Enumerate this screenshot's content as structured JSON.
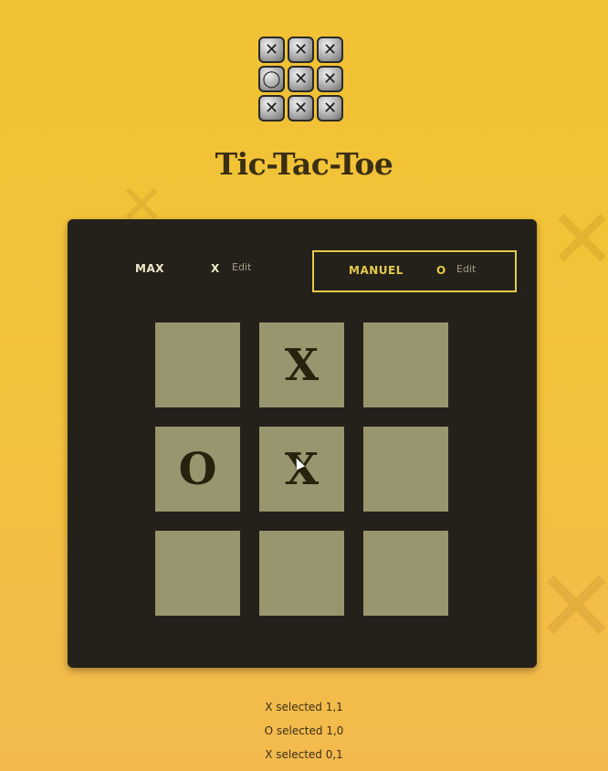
{
  "app": {
    "title": "Tic-Tac-Toe",
    "logo_tiles": [
      "✕",
      "✕",
      "✕",
      "◯",
      "✕",
      "✕",
      "✕",
      "✕",
      "✕"
    ]
  },
  "players": [
    {
      "name": "MAX",
      "symbol": "X",
      "edit_label": "Edit",
      "active": false
    },
    {
      "name": "MANUEL",
      "symbol": "O",
      "edit_label": "Edit",
      "active": true
    }
  ],
  "board": [
    [
      "",
      "X",
      ""
    ],
    [
      "O",
      "X",
      ""
    ],
    [
      "",
      "",
      ""
    ]
  ],
  "log": [
    "X selected 1,1",
    "O selected 1,0",
    "X selected 0,1"
  ],
  "colors": {
    "background": "#f1c234",
    "panel": "#23211a",
    "cell": "#99956e",
    "active_accent": "#e4c94a"
  }
}
